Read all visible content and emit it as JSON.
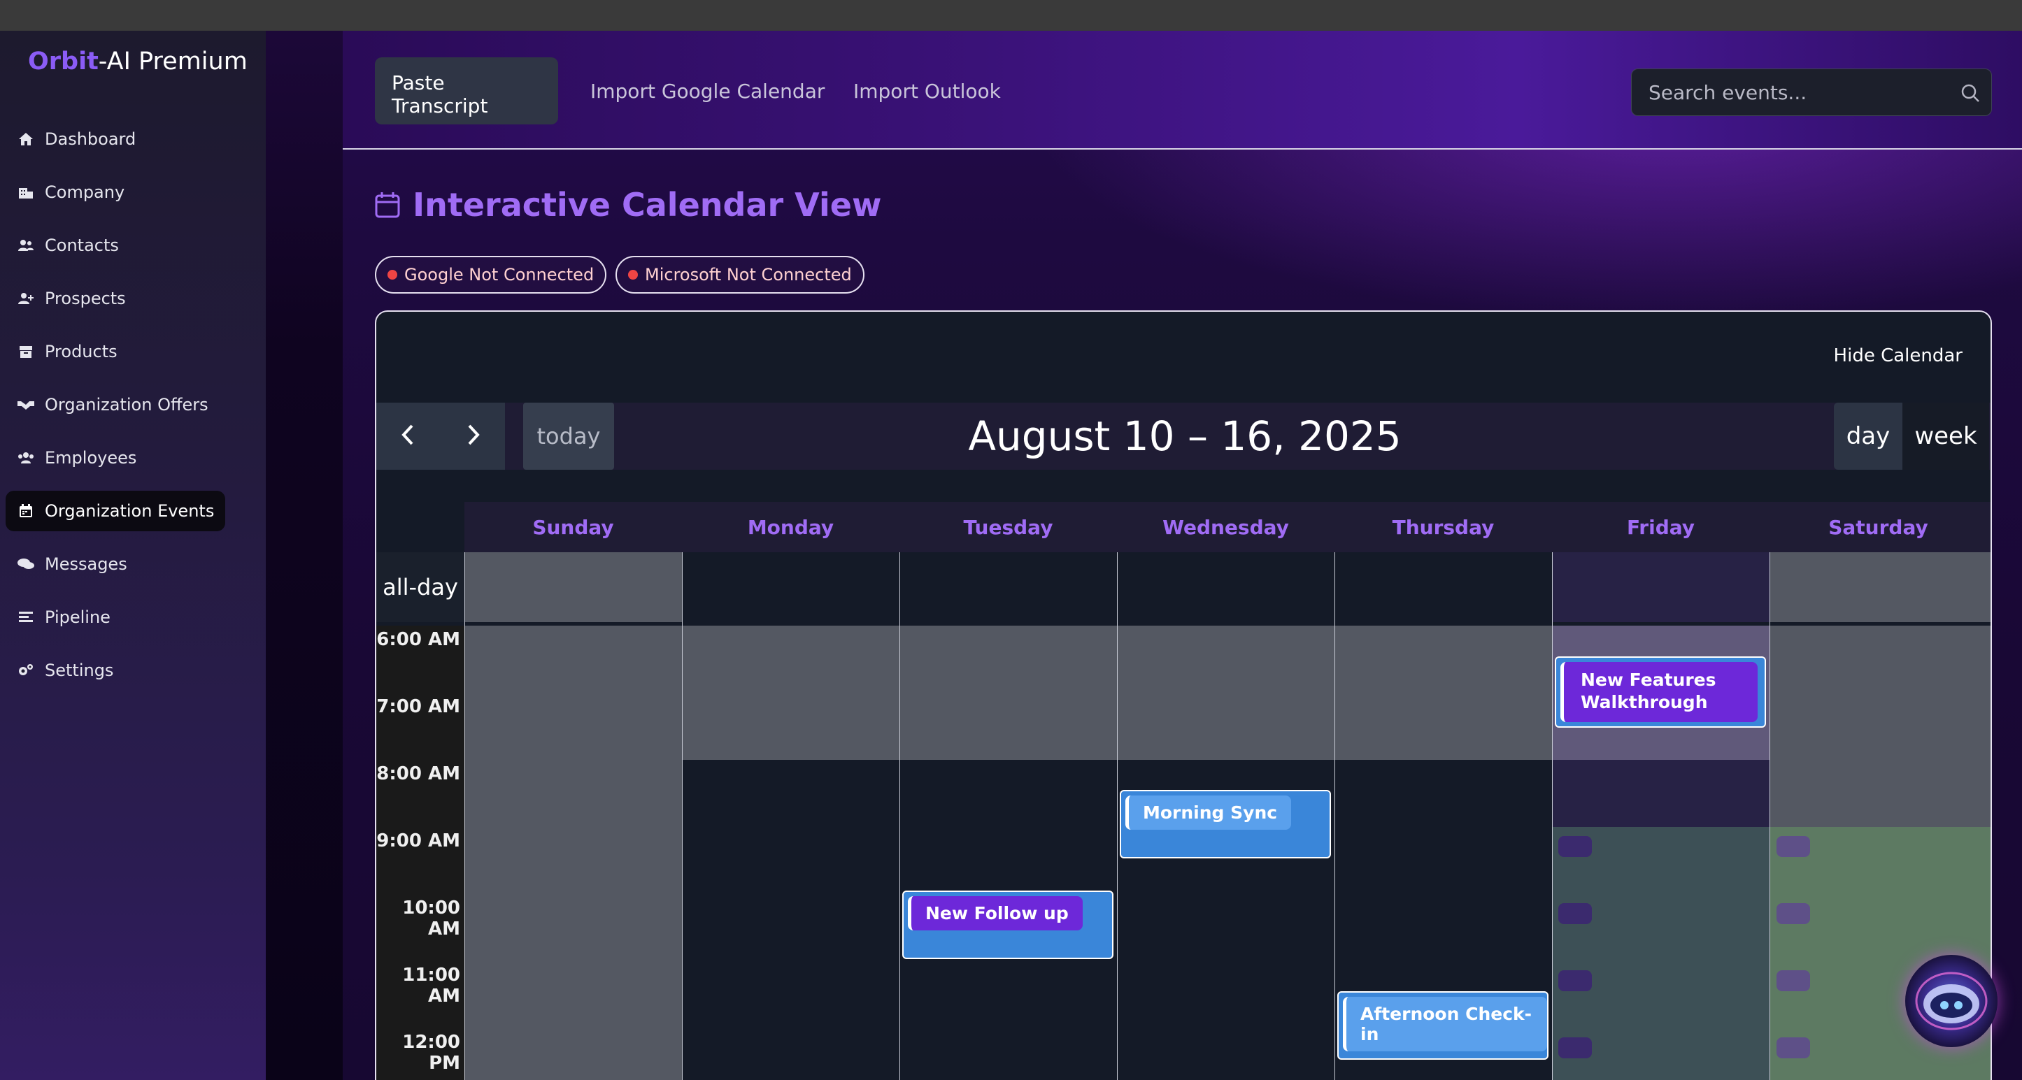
{
  "brand": {
    "prefix": "Orbit",
    "suffix": "-AI Premium"
  },
  "sidebar": {
    "items": [
      {
        "label": "Dashboard",
        "icon": "home-icon",
        "active": false
      },
      {
        "label": "Company",
        "icon": "building-icon",
        "active": false
      },
      {
        "label": "Contacts",
        "icon": "users-icon",
        "active": false
      },
      {
        "label": "Prospects",
        "icon": "user-plus-icon",
        "active": false
      },
      {
        "label": "Products",
        "icon": "box-icon",
        "active": false
      },
      {
        "label": "Organization Offers",
        "icon": "handshake-icon",
        "active": false
      },
      {
        "label": "Employees",
        "icon": "people-group-icon",
        "active": false
      },
      {
        "label": "Organization Events",
        "icon": "calendar-icon",
        "active": true
      },
      {
        "label": "Messages",
        "icon": "chat-icon",
        "active": false
      },
      {
        "label": "Pipeline",
        "icon": "bars-icon",
        "active": false
      },
      {
        "label": "Settings",
        "icon": "gears-icon",
        "active": false
      }
    ]
  },
  "topbar": {
    "tabs": [
      {
        "label": "Paste Transcript",
        "active": true
      },
      {
        "label": "Import Google Calendar",
        "active": false
      },
      {
        "label": "Import Outlook",
        "active": false
      }
    ],
    "search_placeholder": "Search events..."
  },
  "page": {
    "title": "Interactive Calendar View",
    "badges": [
      "Google Not Connected",
      "Microsoft Not Connected"
    ]
  },
  "calendar": {
    "hide_label": "Hide Calendar",
    "today_label": "today",
    "range_title": "August 10 – 16, 2025",
    "views": [
      "day",
      "week"
    ],
    "active_view": "week",
    "allday_label": "all-day",
    "days": [
      "Sunday",
      "Monday",
      "Tuesday",
      "Wednesday",
      "Thursday",
      "Friday",
      "Saturday"
    ],
    "times": [
      "6:00 AM",
      "7:00 AM",
      "8:00 AM",
      "9:00 AM",
      "10:00 AM",
      "11:00 AM",
      "12:00 PM"
    ],
    "events": [
      {
        "title": "New Features Walkthrough",
        "day": "Friday"
      },
      {
        "title": "Morning Sync",
        "day": "Wednesday"
      },
      {
        "title": "New Follow up",
        "day": "Tuesday"
      },
      {
        "title": "Afternoon Check-in",
        "day": "Thursday"
      }
    ]
  },
  "colors": {
    "accent": "#a06cf5",
    "event_blue": "#3a86d9",
    "event_purple": "#6d28d9",
    "status_red": "#ef4444"
  }
}
